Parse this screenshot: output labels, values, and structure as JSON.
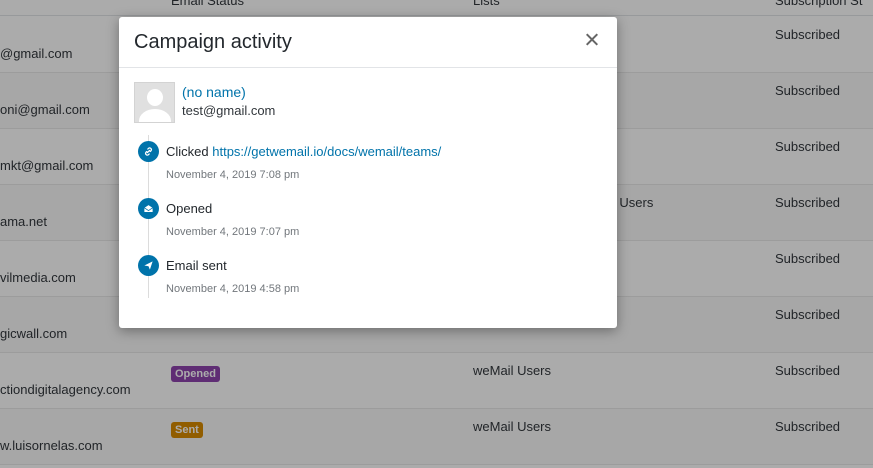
{
  "table": {
    "headers": [
      "Email Status",
      "Lists",
      "Subscription St"
    ],
    "rows": [
      {
        "email": "@gmail.com",
        "badge": "",
        "list": "",
        "status": "Subscribed"
      },
      {
        "email": "oni@gmail.com",
        "badge": "",
        "list": "",
        "status": "Subscribed"
      },
      {
        "email": "mkt@gmail.com",
        "badge": "",
        "list": "",
        "status": "Subscribed"
      },
      {
        "email": "ama.net",
        "badge": "",
        "list": "il Users",
        "status": "Subscribed"
      },
      {
        "email": "vilmedia.com",
        "badge": "",
        "list": "",
        "status": "Subscribed"
      },
      {
        "email": "gicwall.com",
        "badge": "",
        "list": "",
        "status": "Subscribed"
      },
      {
        "email": "ctiondigitalagency.com",
        "badge": "Opened",
        "list": "weMail Users",
        "status": "Subscribed"
      },
      {
        "email": "w.luisornelas.com",
        "badge": "Sent",
        "list": "weMail Users",
        "status": "Subscribed"
      }
    ]
  },
  "colors": {
    "opened_badge": "#8e44ad",
    "sent_badge": "#d98b00",
    "accent": "#0073aa"
  },
  "modal": {
    "title": "Campaign activity",
    "subscriber": {
      "name": "(no name)",
      "email": "test@gmail.com"
    },
    "events": [
      {
        "icon": "link-icon",
        "label": "Clicked",
        "link": "https://getwemail.io/docs/wemail/teams/",
        "time": "November 4, 2019 7:08 pm"
      },
      {
        "icon": "envelope-open-icon",
        "label": "Opened",
        "link": "",
        "time": "November 4, 2019 7:07 pm"
      },
      {
        "icon": "paper-plane-icon",
        "label": "Email sent",
        "link": "",
        "time": "November 4, 2019 4:58 pm"
      }
    ]
  }
}
